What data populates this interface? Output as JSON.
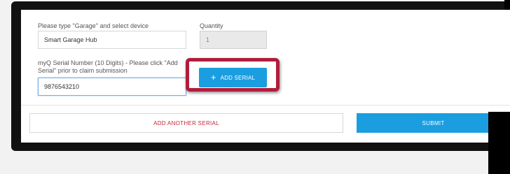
{
  "form": {
    "device_label": "Please type \"Garage\" and select device",
    "device_value": "Smart Garage Hub",
    "quantity_label": "Quantity",
    "quantity_value": "1",
    "serial_label_line1": "myQ Serial Number (10 Digits) - Please click \"Add",
    "serial_label_line2": "Serial\" prior to claim submission",
    "serial_value": "9876543210",
    "add_serial_icon": "+",
    "add_serial_label": "ADD SERIAL"
  },
  "footer": {
    "add_another_label": "ADD ANOTHER SERIAL",
    "submit_label": "SUBMIT"
  },
  "colors": {
    "primary": "#1a9ee0",
    "highlight": "#b01d3c",
    "danger_text": "#c8243a"
  }
}
